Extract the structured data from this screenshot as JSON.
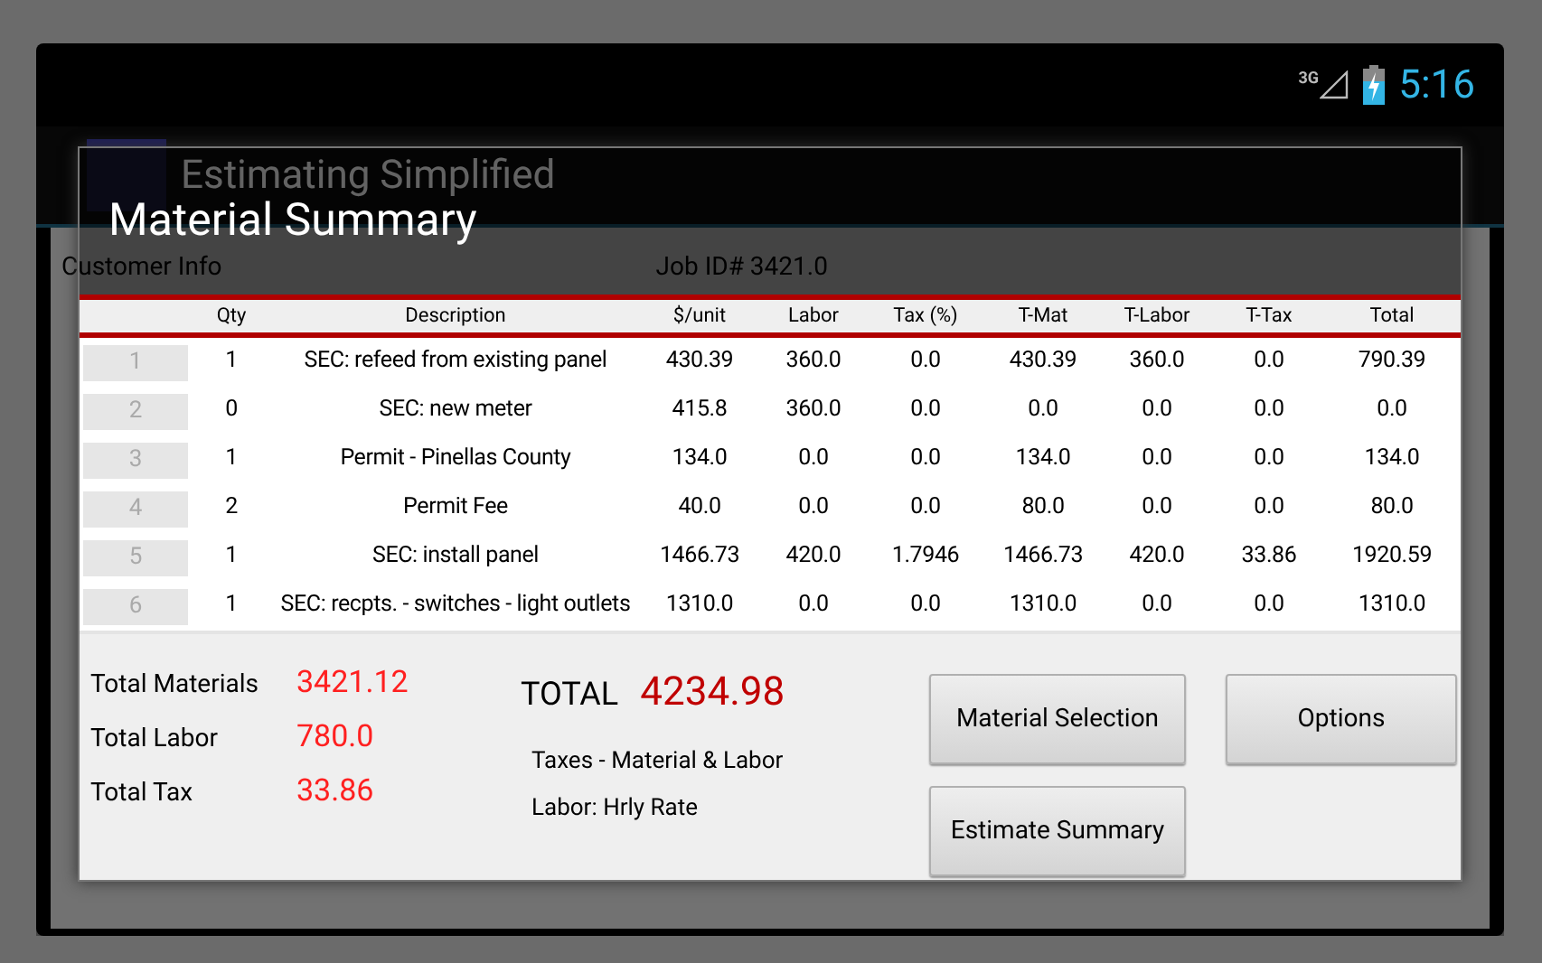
{
  "status_bar": {
    "network": "3G",
    "time": "5:16"
  },
  "app": {
    "title": "Estimating Simplified",
    "customer_label": "Customer Info",
    "job_id": "Job ID# 3421.0"
  },
  "dialog": {
    "title": "Material Summary",
    "table": {
      "columns": [
        "Qty",
        "Description",
        "$/unit",
        "Labor",
        "Tax (%)",
        "T-Mat",
        "T-Labor",
        "T-Tax",
        "Total"
      ],
      "rows": [
        {
          "number": "1",
          "cells": [
            "1",
            "SEC: refeed from existing panel",
            "430.39",
            "360.0",
            "0.0",
            "430.39",
            "360.0",
            "0.0",
            "790.39"
          ]
        },
        {
          "number": "2",
          "cells": [
            "0",
            "SEC: new meter",
            "415.8",
            "360.0",
            "0.0",
            "0.0",
            "0.0",
            "0.0",
            "0.0"
          ]
        },
        {
          "number": "3",
          "cells": [
            "1",
            "Permit - Pinellas County",
            "134.0",
            "0.0",
            "0.0",
            "134.0",
            "0.0",
            "0.0",
            "134.0"
          ]
        },
        {
          "number": "4",
          "cells": [
            "2",
            "Permit Fee",
            "40.0",
            "0.0",
            "0.0",
            "80.0",
            "0.0",
            "0.0",
            "80.0"
          ]
        },
        {
          "number": "5",
          "cells": [
            "1",
            "SEC: install panel",
            "1466.73",
            "420.0",
            "1.7946",
            "1466.73",
            "420.0",
            "33.86",
            "1920.59"
          ]
        },
        {
          "number": "6",
          "cells": [
            "1",
            "SEC: recpts. - switches - light outlets",
            "1310.0",
            "0.0",
            "0.0",
            "1310.0",
            "0.0",
            "0.0",
            "1310.0"
          ]
        }
      ]
    },
    "totals": [
      {
        "label": "Total Materials",
        "value": "3421.12"
      },
      {
        "label": "Total Labor",
        "value": "780.0"
      },
      {
        "label": "Total Tax",
        "value": "33.86"
      }
    ],
    "grand_total": {
      "label": "TOTAL",
      "value": "4234.98"
    },
    "notes": [
      "Taxes - Material & Labor",
      "Labor: Hrly Rate"
    ],
    "buttons": [
      "Material Selection",
      "Options",
      "Estimate Summary"
    ]
  }
}
